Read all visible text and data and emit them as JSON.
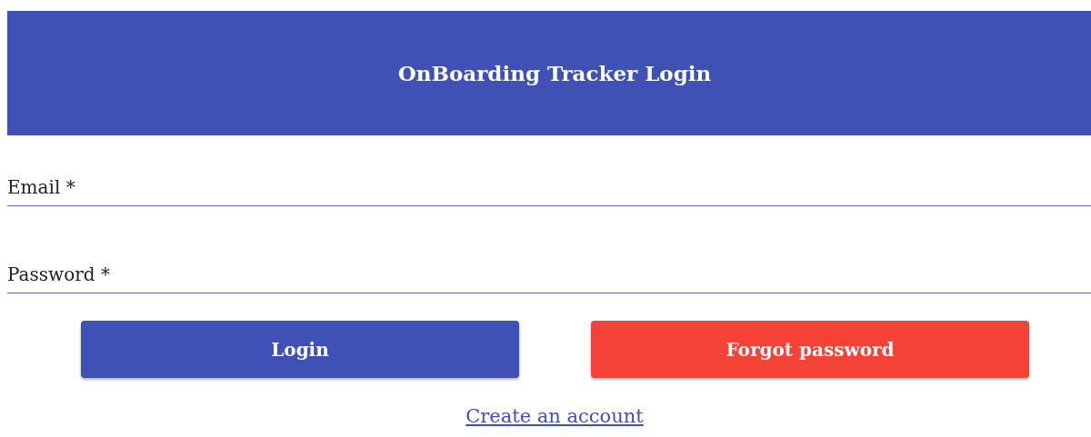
{
  "header": {
    "title": "OnBoarding Tracker Login"
  },
  "fields": [
    {
      "placeholder": "Email *"
    },
    {
      "placeholder": "Password *"
    }
  ],
  "buttons": [
    {
      "kind": "primary",
      "label": "Login"
    },
    {
      "kind": "danger",
      "label": "Forgot password"
    }
  ],
  "link": {
    "label": "Create an account"
  }
}
